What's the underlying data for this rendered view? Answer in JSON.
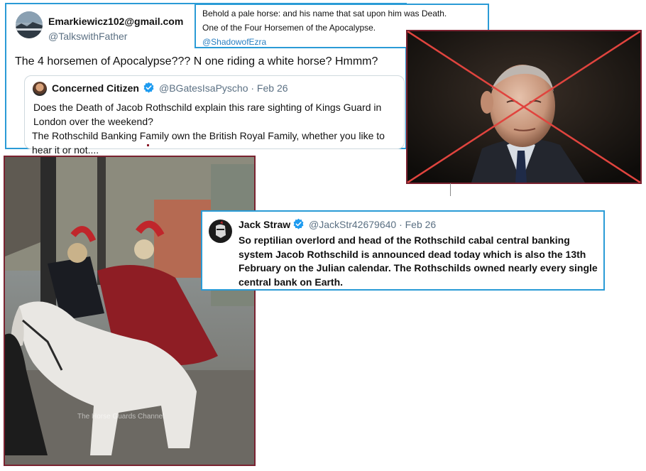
{
  "main_tweet": {
    "author_name": "Emarkiewicz102@gmail.com",
    "author_handle": "@TalkswithFather",
    "text": "The 4 horsemen of Apocalypse??? N one riding a white horse? Hmmm?",
    "quoted": {
      "author_name": "Concerned Citizen",
      "author_handle": "@BGatesIsaPyscho · Feb 26",
      "text_1": "Does the Death of Jacob Rothschild explain this rare sighting of Kings Guard in London over the weekend?",
      "text_2": "The Rothschild Banking Family own the British Royal Family, whether you like to hear it or not...."
    }
  },
  "horse_quote": {
    "line_1": "Behold a pale horse: and his name that sat upon him was Death.",
    "line_2": "One of the Four Horsemen of the Apocalypse.",
    "handle": "@ShadowofEzra"
  },
  "portrait": {
    "cross_color": "#e0443e",
    "frame_color": "#7a2230"
  },
  "video_still": {
    "watermark": "The Horse Guards Channel"
  },
  "straw_tweet": {
    "author_name": "Jack Straw",
    "author_handle": "@JackStr42679640 · Feb 26",
    "text": "So reptilian overlord and head of the Rothschild cabal central banking system Jacob Rothschild is announced dead today which is also the 13th February on the Julian calendar. The Rothschilds owned nearly every single central bank on Earth."
  },
  "colors": {
    "tweet_border": "#2a9bd6",
    "photo_border": "#7a2230",
    "verified_blue": "#1d9bf0"
  }
}
